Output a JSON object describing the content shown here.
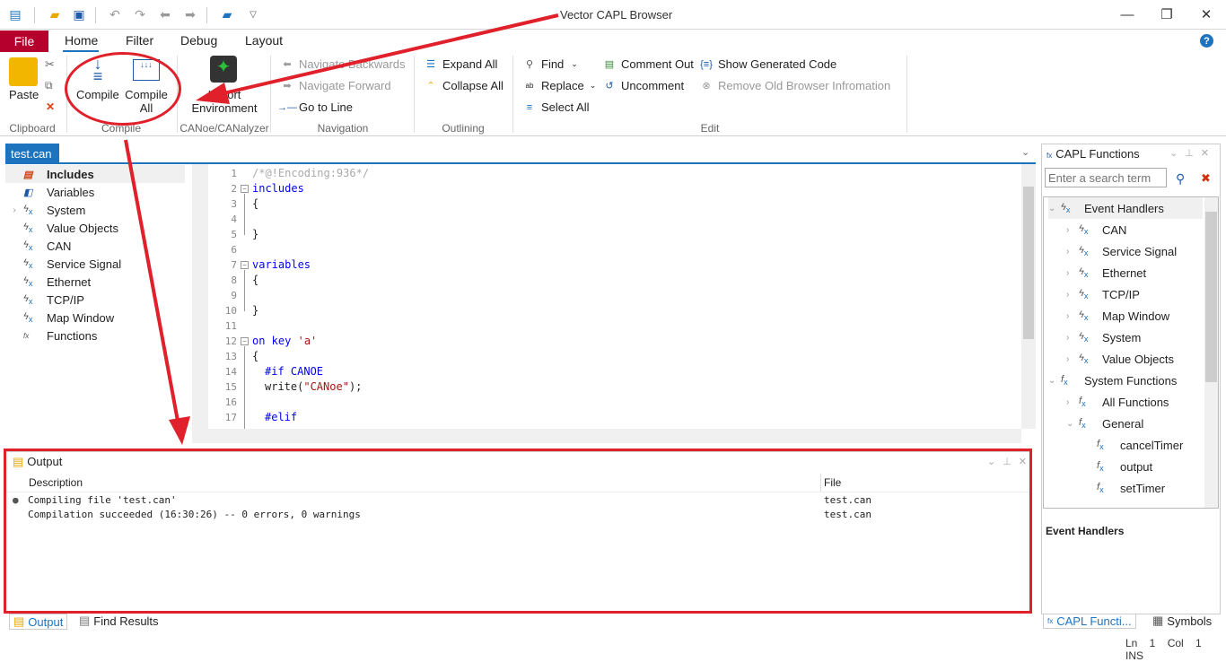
{
  "window": {
    "title": "Vector CAPL Browser"
  },
  "menu": {
    "file": "File",
    "tabs": [
      "Home",
      "Filter",
      "Debug",
      "Layout"
    ]
  },
  "ribbon": {
    "clipboard": {
      "paste": "Paste",
      "group": "Clipboard"
    },
    "compile": {
      "compile": "Compile",
      "compile_all_1": "Compile",
      "compile_all_2": "All",
      "group": "Compile"
    },
    "canoe": {
      "import_1": "Import",
      "import_2": "Environment",
      "group": "CANoe/CANalyzer"
    },
    "navigation": {
      "back": "Navigate Backwards",
      "forward": "Navigate Forward",
      "goto": "Go to Line",
      "group": "Navigation"
    },
    "outlining": {
      "expand": "Expand All",
      "collapse": "Collapse All",
      "group": "Outlining"
    },
    "edit": {
      "find": "Find",
      "replace": "Replace",
      "select_all": "Select All",
      "comment": "Comment Out",
      "uncomment": "Uncomment",
      "show_code": "Show Generated Code",
      "remove_old": "Remove Old Browser Infromation",
      "group": "Edit"
    }
  },
  "document": {
    "tab": "test.can"
  },
  "outline": [
    "Includes",
    "Variables",
    "System",
    "Value Objects",
    "CAN",
    "Service Signal",
    "Ethernet",
    "TCP/IP",
    "Map Window",
    "Functions"
  ],
  "code": {
    "lines": [
      "1",
      "2",
      "3",
      "4",
      "5",
      "6",
      "7",
      "8",
      "9",
      "10",
      "11",
      "12",
      "13",
      "14",
      "15",
      "16",
      "17"
    ],
    "l1": "/*@!Encoding:936*/",
    "l2": "includes",
    "brace_open": "{",
    "brace_close": "}",
    "l7": "variables",
    "l12_kw": "on key",
    "l12_str": "'a'",
    "l14": "#if CANOE",
    "l15_fn": "write(",
    "l15_str": "\"CANoe\"",
    "l15_end": ");",
    "l17": "#elif"
  },
  "capl_functions": {
    "title": "CAPL Functions",
    "search_placeholder": "Enter a search term",
    "tree": [
      "Event Handlers",
      "CAN",
      "Service Signal",
      "Ethernet",
      "TCP/IP",
      "Map Window",
      "System",
      "Value Objects",
      "System Functions",
      "All Functions",
      "General",
      "cancelTimer",
      "output",
      "setTimer"
    ],
    "info_title": "Event Handlers"
  },
  "output": {
    "title": "Output",
    "columns": [
      "Description",
      "File"
    ],
    "rows": [
      {
        "description": "Compiling file 'test.can'",
        "file": "test.can"
      },
      {
        "description": "Compilation succeeded (16:30:26) -- 0 errors, 0 warnings",
        "file": "test.can"
      }
    ]
  },
  "bottom_tabs": [
    "Output",
    "Find Results"
  ],
  "right_tabs": [
    "CAPL Functi...",
    "Symbols"
  ],
  "status": {
    "ln": "Ln 1",
    "col": "Col 1",
    "mode": "INS"
  }
}
